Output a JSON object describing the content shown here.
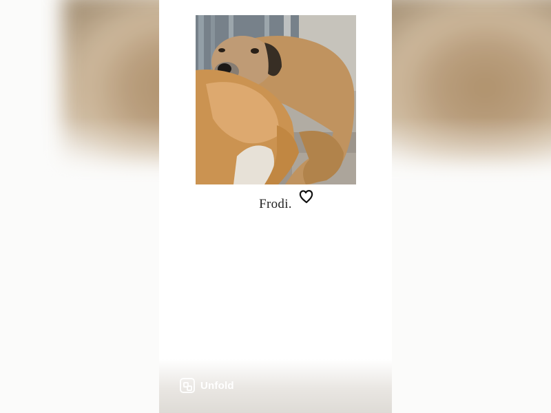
{
  "story": {
    "caption": "Frodi.",
    "decoration_icon": "heart-icon",
    "brand_icon": "unfold-logo-icon",
    "brand_name": "Unfold"
  },
  "colors": {
    "background": "#ffffff",
    "caption_text": "#222222",
    "brand_text": "#ffffff",
    "bottom_bar": "#dedbd6"
  }
}
